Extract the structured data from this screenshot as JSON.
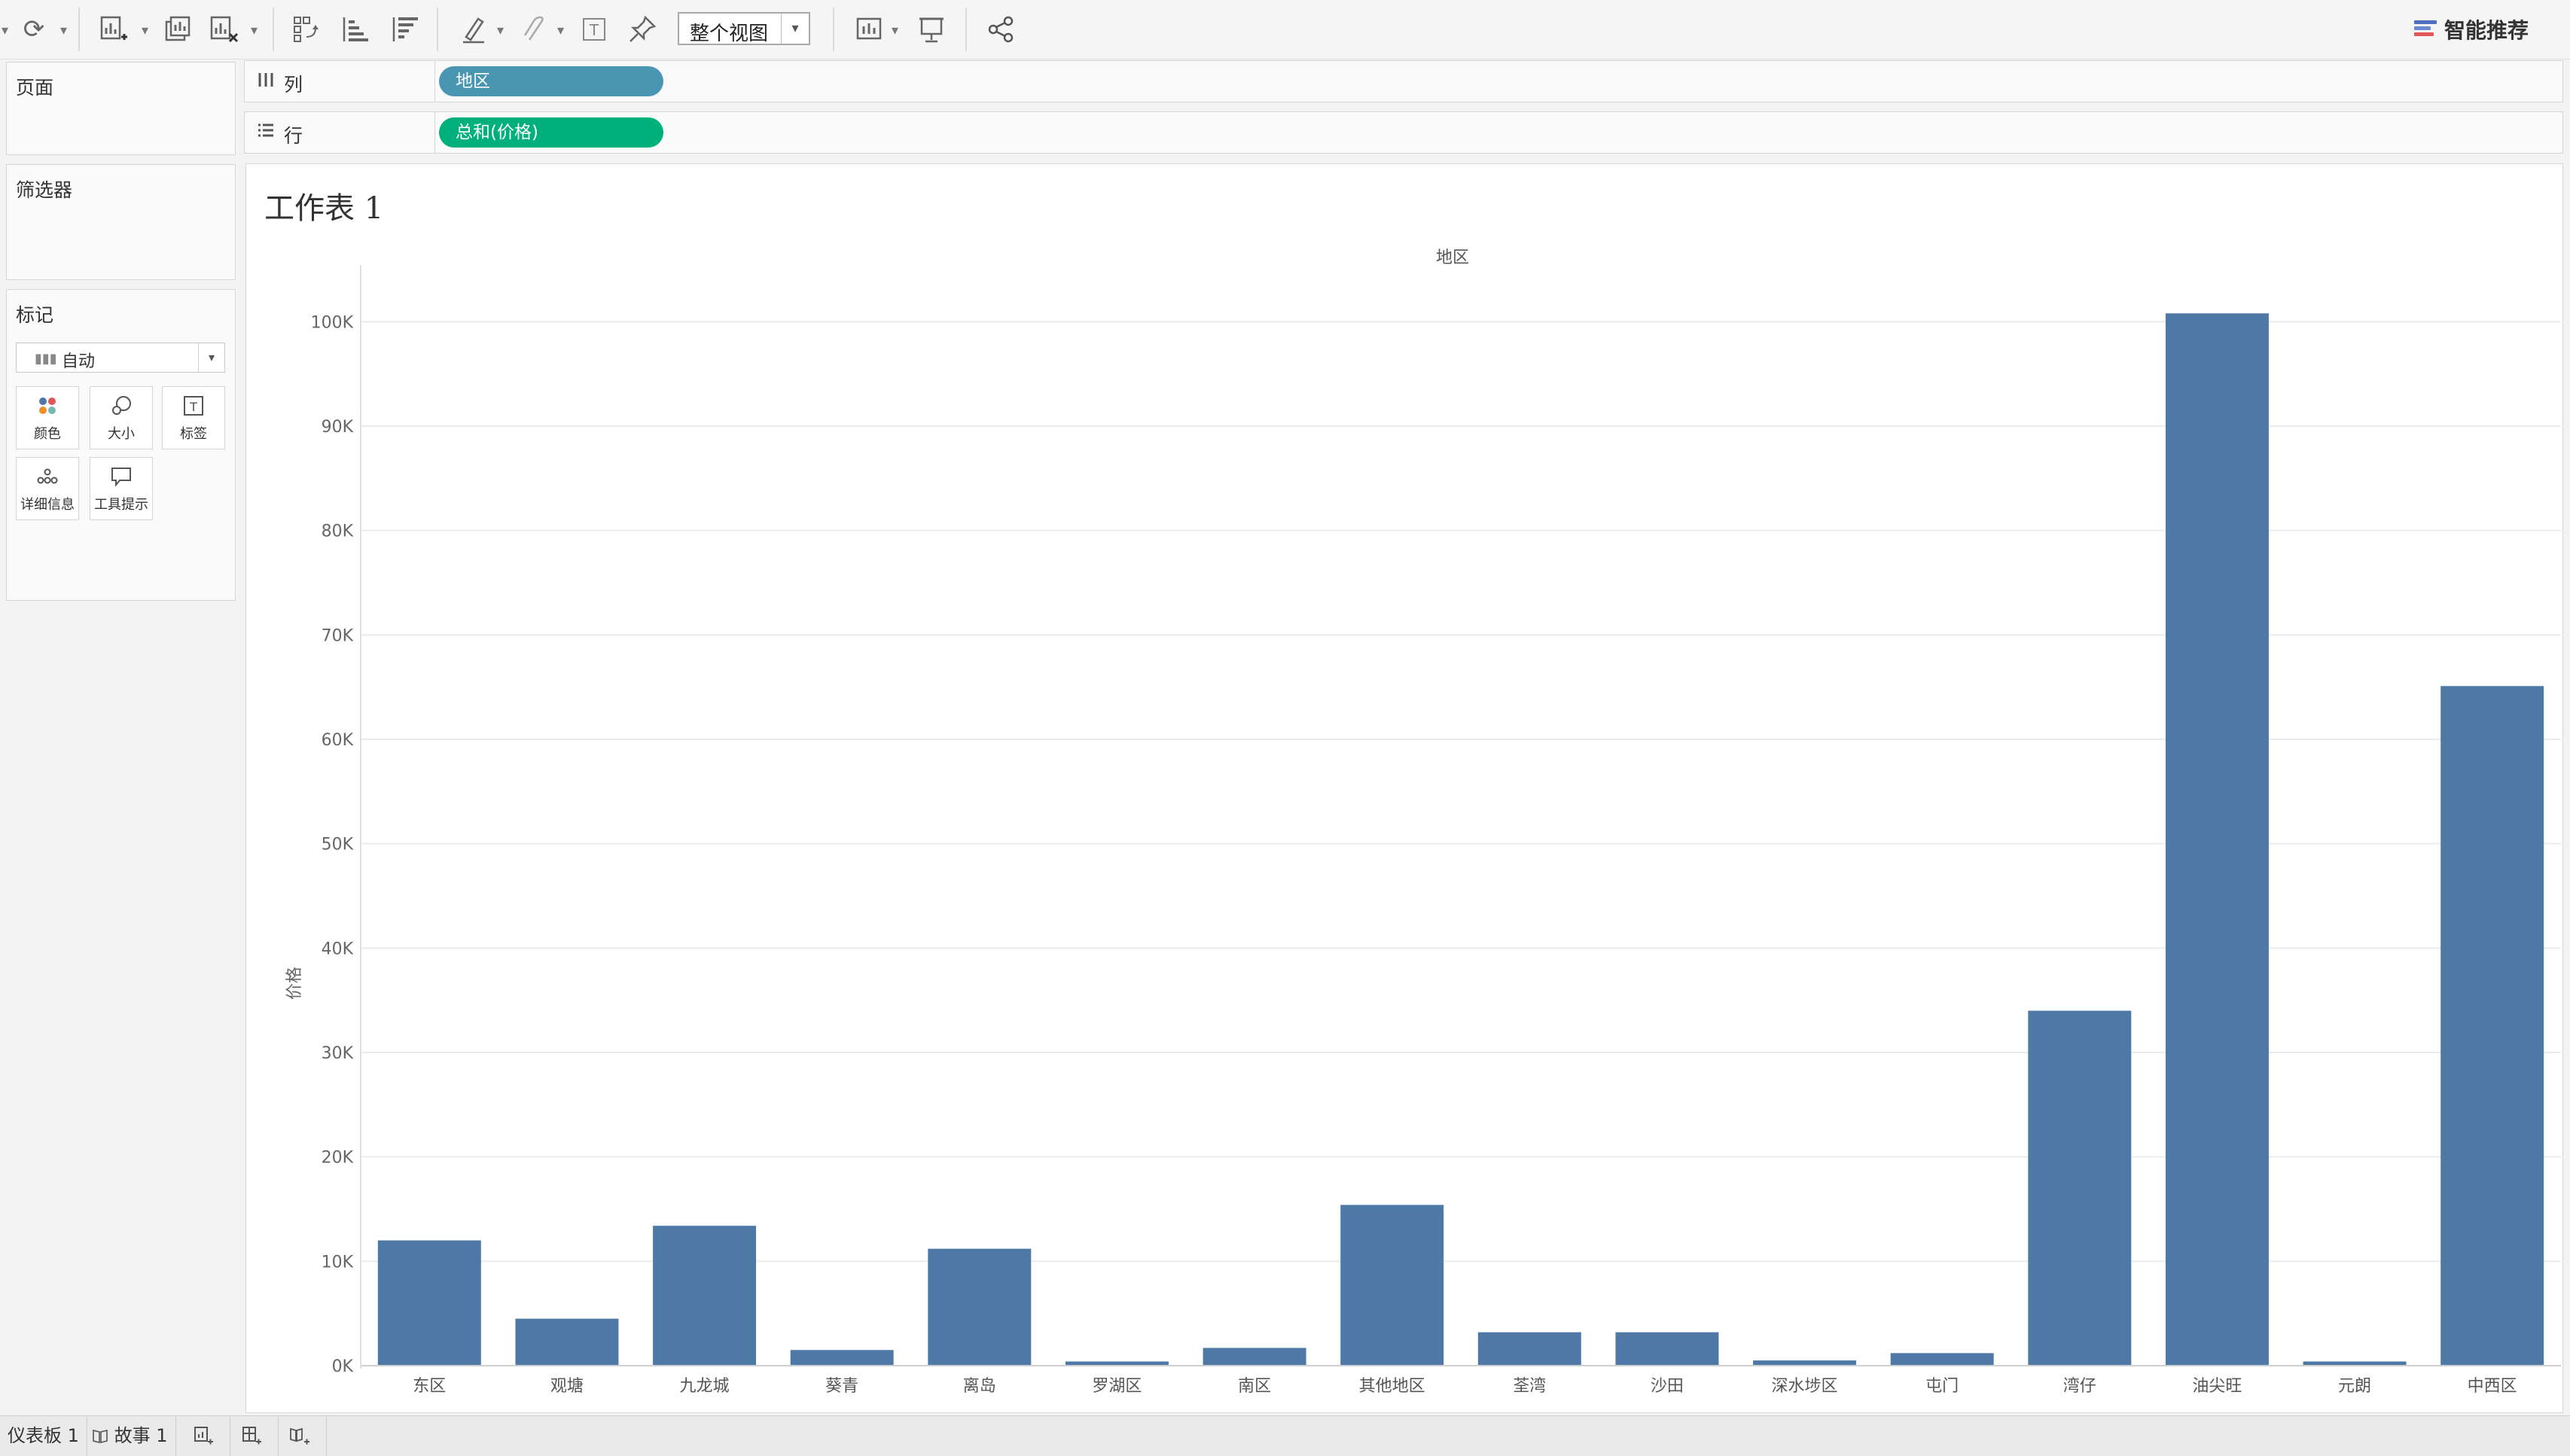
{
  "toolbar": {
    "view_select": "整个视图",
    "smart_recommend": "智能推荐"
  },
  "left": {
    "pages": "页面",
    "filters": "筛选器",
    "marks": "标记",
    "marks_type": "自动",
    "mark_buttons": [
      "颜色",
      "大小",
      "标签",
      "详细信息",
      "工具提示"
    ]
  },
  "shelves": {
    "columns_label": "列",
    "columns_pill": "地区",
    "rows_label": "行",
    "rows_pill": "总和(价格)"
  },
  "colors": {
    "bar": "#4e79a7",
    "columns_pill": "#4996b2",
    "rows_pill": "#00b07a"
  },
  "worksheet": {
    "title": "工作表 1",
    "x_axis_title": "地区",
    "y_axis_title": "价格"
  },
  "chart_data": {
    "type": "bar",
    "title": "工作表 1",
    "xlabel": "地区",
    "ylabel": "价格",
    "categories": [
      "东区",
      "观塘",
      "九龙城",
      "葵青",
      "离岛",
      "罗湖区",
      "南区",
      "其他地区",
      "荃湾",
      "沙田",
      "深水埗区",
      "屯门",
      "湾仔",
      "油尖旺",
      "元朗",
      "中西区"
    ],
    "values": [
      12000,
      4500,
      13400,
      1500,
      11200,
      400,
      1700,
      15400,
      3200,
      3200,
      500,
      1200,
      34000,
      100800,
      400,
      65100
    ],
    "ylim": [
      0,
      105000
    ],
    "yticks": [
      0,
      10000,
      20000,
      30000,
      40000,
      50000,
      60000,
      70000,
      80000,
      90000,
      100000
    ],
    "ytick_labels": [
      "0K",
      "10K",
      "20K",
      "30K",
      "40K",
      "50K",
      "60K",
      "70K",
      "80K",
      "90K",
      "100K"
    ],
    "grid": true
  },
  "bottom_tabs": [
    "仪表板 1",
    "故事 1"
  ]
}
